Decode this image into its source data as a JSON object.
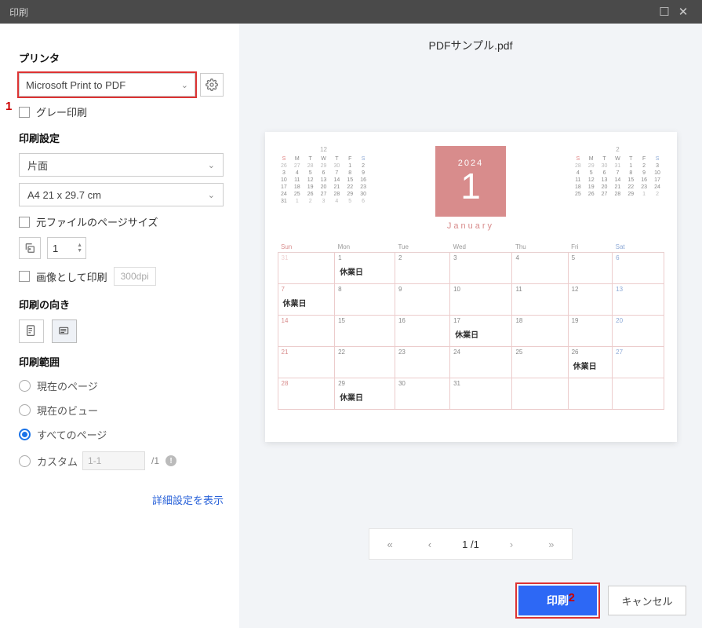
{
  "titlebar": {
    "title": "印刷"
  },
  "annot": {
    "one": "1",
    "two": "2"
  },
  "sidebar": {
    "printer_heading": "プリンタ",
    "printer_selected": "Microsoft Print to PDF",
    "gray_print": "グレー印刷",
    "settings_heading": "印刷設定",
    "duplex": "片面",
    "paper": "A4 21 x 29.7 cm",
    "original_size": "元ファイルのページサイズ",
    "copies": "1",
    "print_as_image": "画像として印刷",
    "dpi": "300dpi",
    "orientation_heading": "印刷の向き",
    "range_heading": "印刷範囲",
    "current_page": "現在のページ",
    "current_view": "現在のビュー",
    "all_pages": "すべてのページ",
    "custom": "カスタム",
    "custom_ph": "1-1",
    "custom_total": "/1",
    "advanced_link": "詳細設定を表示"
  },
  "preview": {
    "doc_title": "PDFサンプル.pdf",
    "big_year": "2024",
    "big_month": "1",
    "big_name": "January",
    "dow": {
      "sun": "Sun",
      "mon": "Mon",
      "tue": "Tue",
      "wed": "Wed",
      "thu": "Thu",
      "fri": "Fri",
      "sat": "Sat"
    },
    "event": "休業日",
    "mini_dec": "12",
    "mini_feb": "2",
    "pager_label": "1 /1"
  },
  "footer": {
    "print": "印刷",
    "cancel": "キャンセル"
  }
}
